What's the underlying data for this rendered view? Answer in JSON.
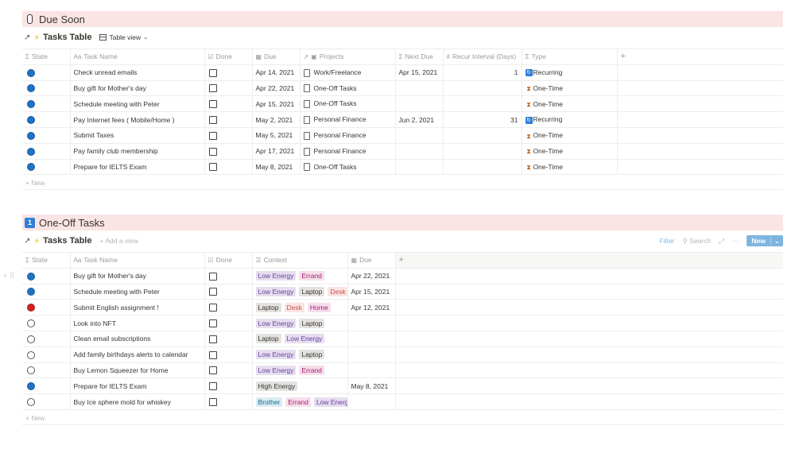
{
  "section1": {
    "title": "Due Soon",
    "db_title": "Tasks Table",
    "view_label": "Table view",
    "columns": [
      "State",
      "Task Name",
      "Done",
      "Due",
      "Projects",
      "Next Due",
      "Recur Interval (Days)",
      "Type"
    ],
    "rows": [
      {
        "name": "Check unread emails",
        "due": "Apr 14, 2021",
        "project": "Work/Freelance",
        "next_due": "Apr 15, 2021",
        "interval": "1",
        "type": "Recurring"
      },
      {
        "name": "Buy gift for Mother's day",
        "due": "Apr 22, 2021",
        "project": "One-Off Tasks",
        "next_due": "",
        "interval": "",
        "type": "One-Time"
      },
      {
        "name": "Schedule meeting with Peter",
        "due": "Apr 15, 2021",
        "project": "One-Off Tasks",
        "next_due": "",
        "interval": "",
        "type": "One-Time"
      },
      {
        "name": "Pay Internet fees ( Mobile/Home )",
        "due": "May 2, 2021",
        "project": "Personal Finance",
        "next_due": "Jun 2, 2021",
        "interval": "31",
        "type": "Recurring"
      },
      {
        "name": "Submit Taxes",
        "due": "May 5, 2021",
        "project": "Personal Finance",
        "next_due": "",
        "interval": "",
        "type": "One-Time"
      },
      {
        "name": "Pay family club membership",
        "due": "Apr 17, 2021",
        "project": "Personal Finance",
        "next_due": "",
        "interval": "",
        "type": "One-Time"
      },
      {
        "name": "Prepare for IELTS Exam",
        "due": "May 8, 2021",
        "project": "One-Off Tasks",
        "next_due": "",
        "interval": "",
        "type": "One-Time"
      }
    ],
    "new_label": "New"
  },
  "section2": {
    "number": "1",
    "title": "One-Off Tasks",
    "db_title": "Tasks Table",
    "add_view_label": "Add a view",
    "filter_label": "Filter",
    "search_label": "Search",
    "new_button_label": "New",
    "columns": [
      "State",
      "Task Name",
      "Done",
      "Context",
      "Due"
    ],
    "rows": [
      {
        "state": "blue",
        "name": "Buy gift for Mother's day",
        "tags": [
          {
            "t": "Low Energy",
            "c": "purple"
          },
          {
            "t": "Errand",
            "c": "pink"
          }
        ],
        "due": "Apr 22, 2021"
      },
      {
        "state": "blue",
        "name": "Schedule meeting with Peter",
        "tags": [
          {
            "t": "Low Energy",
            "c": "purple"
          },
          {
            "t": "Laptop",
            "c": "gray"
          },
          {
            "t": "Desk",
            "c": "red"
          }
        ],
        "due": "Apr 15, 2021"
      },
      {
        "state": "red",
        "name": "Submit English assignment !",
        "tags": [
          {
            "t": "Laptop",
            "c": "gray"
          },
          {
            "t": "Desk",
            "c": "red"
          },
          {
            "t": "Home",
            "c": "pink"
          }
        ],
        "due": "Apr 12, 2021"
      },
      {
        "state": "empty",
        "name": "Look into NFT",
        "tags": [
          {
            "t": "Low Energy",
            "c": "purple"
          },
          {
            "t": "Laptop",
            "c": "gray"
          }
        ],
        "due": ""
      },
      {
        "state": "empty",
        "name": "Clean email subscriptions",
        "tags": [
          {
            "t": "Laptop",
            "c": "gray"
          },
          {
            "t": "Low Energy",
            "c": "purple"
          }
        ],
        "due": ""
      },
      {
        "state": "empty",
        "name": "Add family birthdays alerts to calendar",
        "tags": [
          {
            "t": "Low Energy",
            "c": "purple"
          },
          {
            "t": "Laptop",
            "c": "gray"
          }
        ],
        "due": ""
      },
      {
        "state": "empty",
        "name": "Buy Lemon Squeezer for Home",
        "tags": [
          {
            "t": "Low Energy",
            "c": "purple"
          },
          {
            "t": "Errand",
            "c": "pink"
          }
        ],
        "due": ""
      },
      {
        "state": "blue",
        "name": "Prepare for IELTS Exam",
        "tags": [
          {
            "t": "High Energy",
            "c": "gray"
          }
        ],
        "due": "May 8, 2021"
      },
      {
        "state": "empty",
        "name": "Buy Ice sphere mold for whiskey",
        "tags": [
          {
            "t": "Brother",
            "c": "blue"
          },
          {
            "t": "Errand",
            "c": "pink"
          },
          {
            "t": "Low Energy",
            "c": "purple"
          }
        ],
        "due": ""
      }
    ],
    "new_label": "New"
  },
  "colors": {
    "header_bg": "#fbe4e4",
    "state_blue": "#1f72c6",
    "state_red": "#d42020",
    "accent": "#7fb6e0"
  }
}
